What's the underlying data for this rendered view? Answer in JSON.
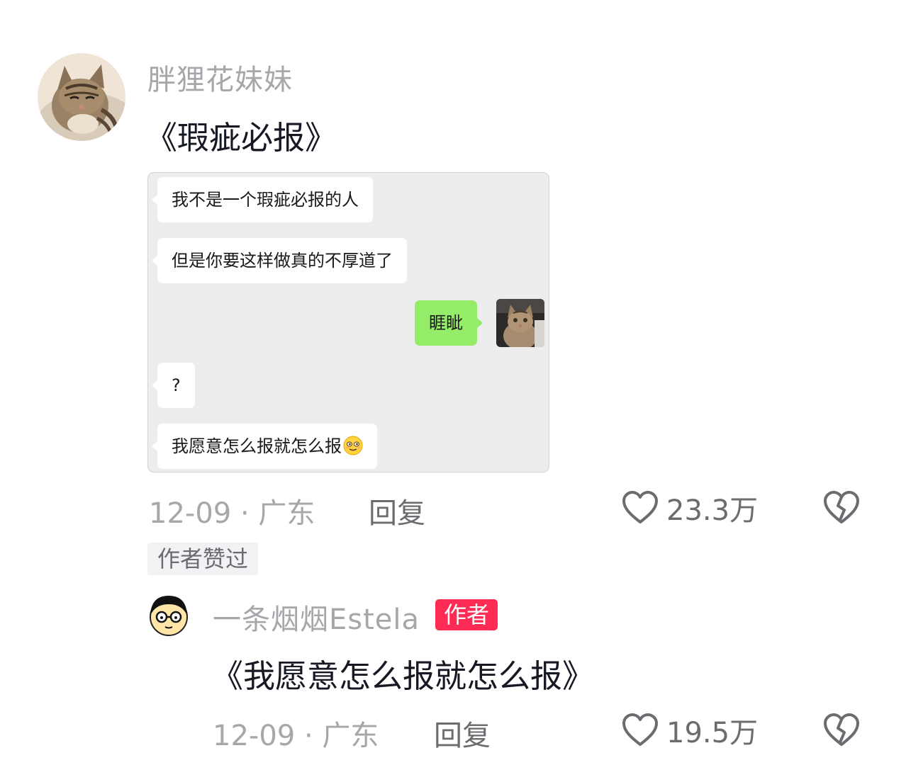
{
  "comment": {
    "username": "胖狸花妹妹",
    "text": "《瑕疵必报》",
    "date": "12-09 · 广东",
    "reply_label": "回复",
    "like_count": "23.3万",
    "author_liked_label": "作者赞过",
    "avatar_icon": "tabby-cat-photo"
  },
  "chat_image": {
    "messages": [
      {
        "side": "left",
        "text": "我不是一个瑕疵必报的人"
      },
      {
        "side": "left",
        "text": "但是你要这样做真的不厚道了"
      },
      {
        "side": "right",
        "text": "睚眦"
      },
      {
        "side": "left",
        "text": "?"
      },
      {
        "side": "left",
        "text": "我愿意怎么报就怎么报"
      }
    ],
    "right_bubble_color": "#95ec69",
    "last_emoji_icon": "smiling-emoji"
  },
  "reply": {
    "username": "一条烟烟Estela",
    "author_badge": "作者",
    "text": "《我愿意怎么报就怎么报》",
    "date": "12-09 · 广东",
    "reply_label": "回复",
    "like_count": "19.5万",
    "avatar_icon": "cartoon-glasses-avatar"
  },
  "colors": {
    "author_badge": "#fe2c55",
    "secondary_text": "#a6a6ab"
  }
}
